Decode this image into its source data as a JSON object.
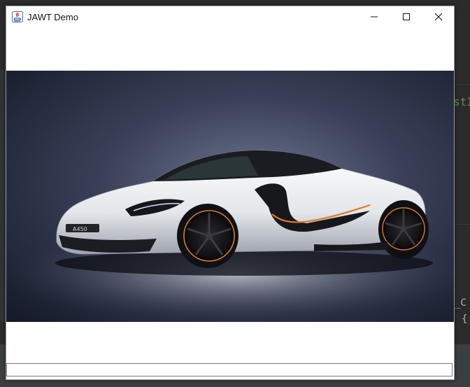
{
  "window": {
    "title": "JAWT Demo"
  },
  "titlebar": {
    "minimize_icon": "minimize-icon",
    "maximize_icon": "maximize-icon",
    "close_icon": "close-icon"
  },
  "background_ide": {
    "fragments": [
      "stI",
      "_C",
      "{"
    ]
  },
  "main": {
    "image": "car-photo",
    "colors": {
      "backdrop": "#1d2233",
      "car_body": "#eef0f2",
      "accent": "#e07a22"
    }
  },
  "text_field": {
    "value": ""
  },
  "ide_bottom": {
    "text": "· · · · · · · · "
  }
}
